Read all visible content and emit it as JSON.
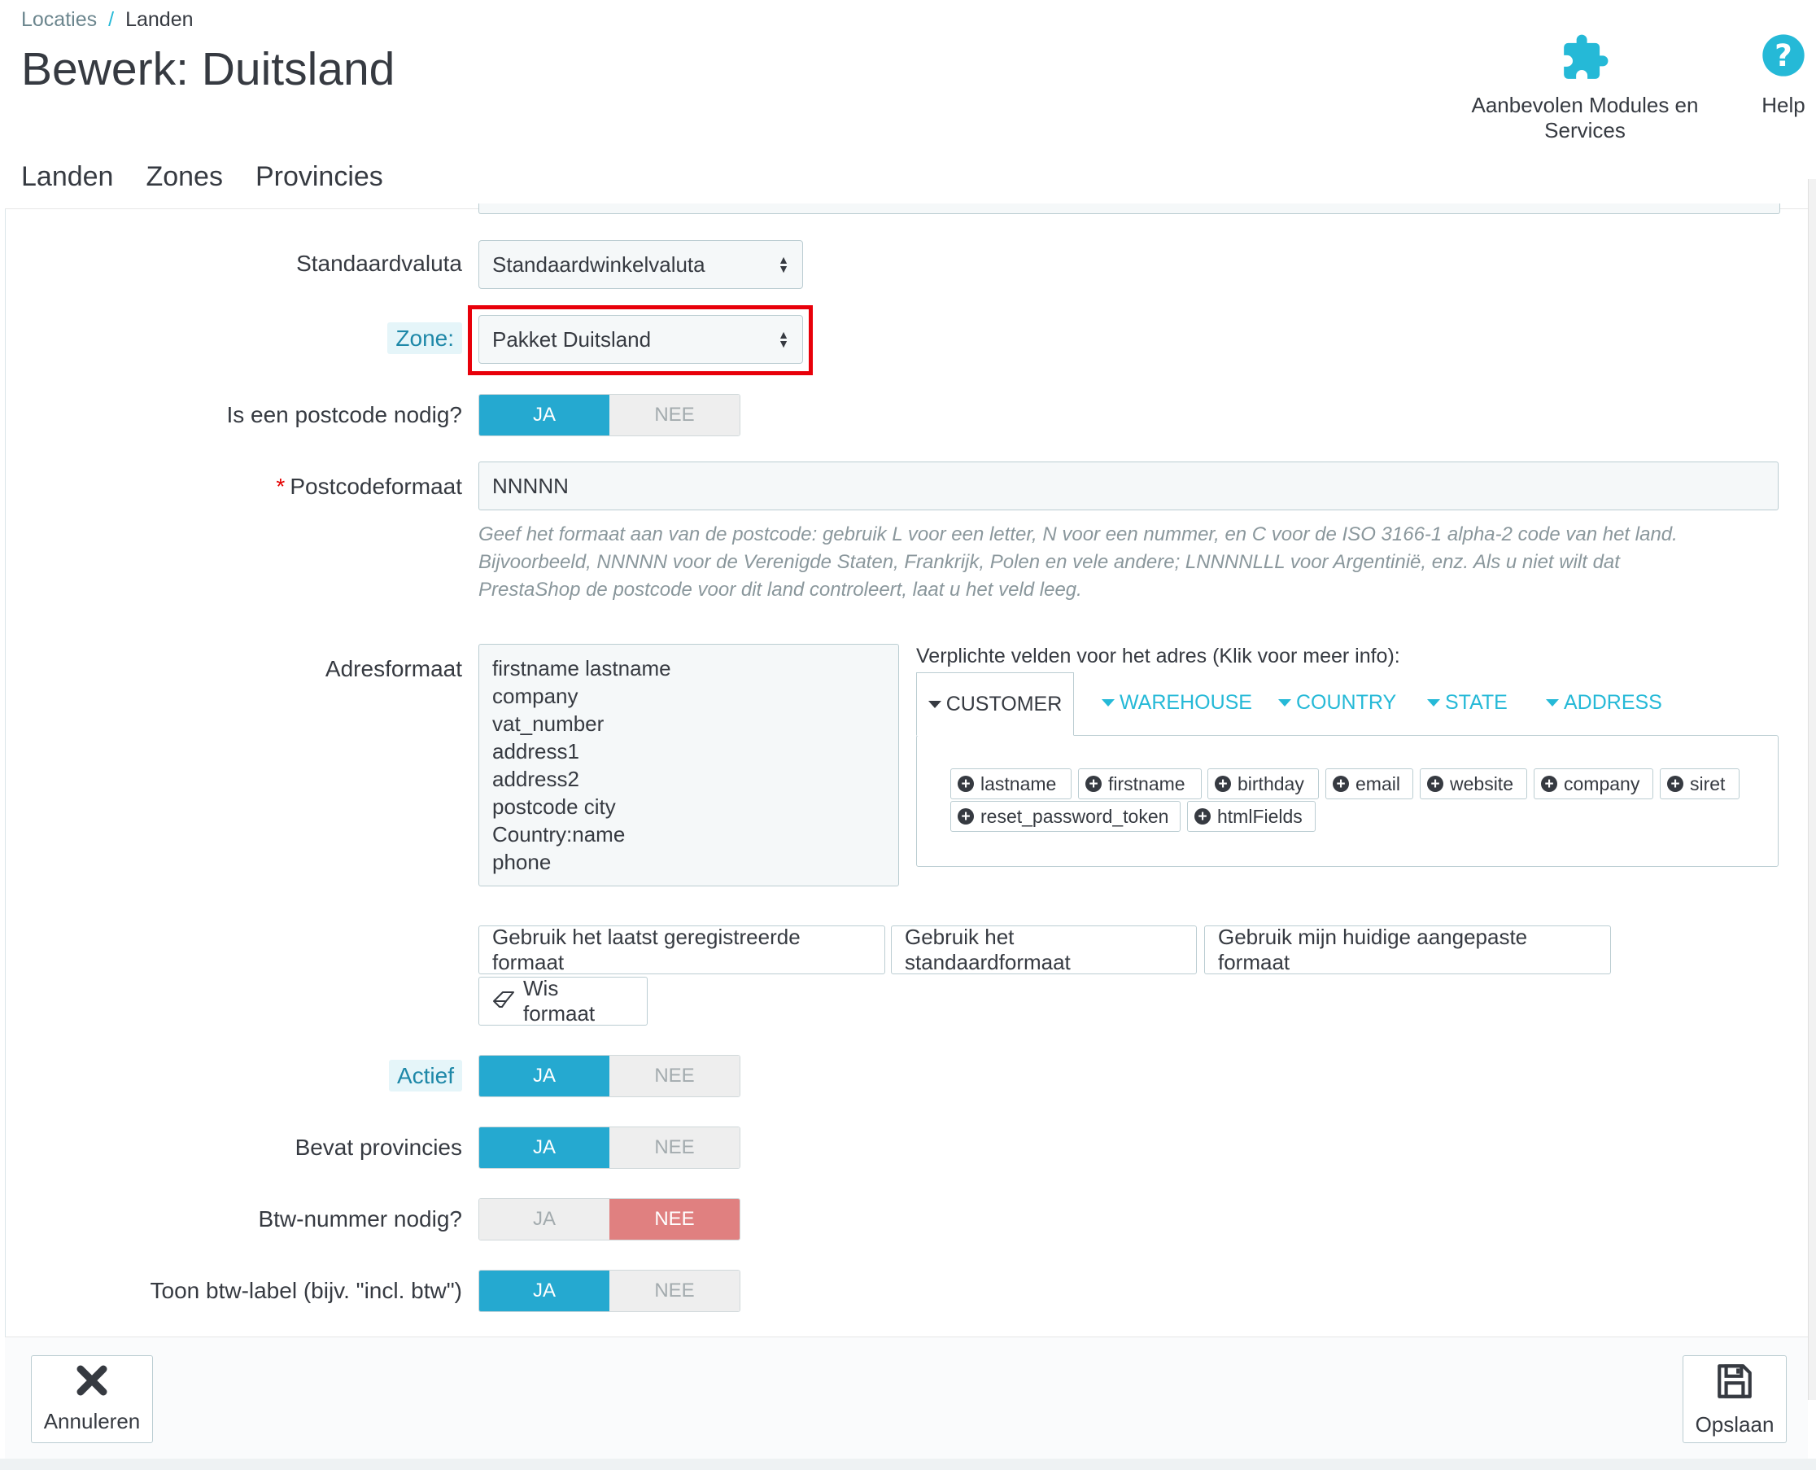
{
  "breadcrumb": {
    "parent": "Locaties",
    "separator": "/",
    "current": "Landen"
  },
  "page_title": "Bewerk: Duitsland",
  "toolbar": {
    "modules_label": "Aanbevolen Modules en Services",
    "help_label": "Help"
  },
  "tabs": [
    {
      "label": "Landen"
    },
    {
      "label": "Zones"
    },
    {
      "label": "Provincies"
    }
  ],
  "form": {
    "currency": {
      "label": "Standaardvaluta",
      "value": "Standaardwinkelvaluta"
    },
    "zone": {
      "label": "Zone:",
      "value": "Pakket Duitsland"
    },
    "zip_required": {
      "label": "Is een postcode nodig?",
      "yes": "JA",
      "no": "NEE",
      "value": "JA"
    },
    "zip_format": {
      "required_mark": "*",
      "label": "Postcodeformaat",
      "value": "NNNNN",
      "help_lines": [
        "Geef het formaat aan van de postcode: gebruik L voor een letter, N voor een nummer, en C voor de ISO 3166-1 alpha-2 code van het land.",
        "Bijvoorbeeld, NNNNN voor de Verenigde Staten, Frankrijk, Polen en vele andere; LNNNNLLL voor Argentinië, enz. Als u niet wilt dat",
        "PrestaShop de postcode voor dit land controleert, laat u het veld leeg."
      ]
    },
    "address_format": {
      "label": "Adresformaat",
      "lines": [
        "firstname lastname",
        "company",
        "vat_number",
        "address1",
        "address2",
        "postcode city",
        "Country:name",
        "phone"
      ]
    },
    "required_fields": {
      "title": "Verplichte velden voor het adres (Klik voor meer info):",
      "tabs": [
        "CUSTOMER",
        "WAREHOUSE",
        "COUNTRY",
        "STATE",
        "ADDRESS"
      ],
      "active_tab": "CUSTOMER",
      "chips": [
        "lastname",
        "firstname",
        "birthday",
        "email",
        "website",
        "company",
        "siret",
        "reset_password_token",
        "htmlFields"
      ]
    },
    "format_buttons": {
      "last": "Gebruik het laatst geregistreerde formaat",
      "default": "Gebruik het standaardformaat",
      "current": "Gebruik mijn huidige aangepaste formaat",
      "clear": "Wis formaat"
    },
    "active": {
      "label": "Actief",
      "yes": "JA",
      "no": "NEE",
      "value": "JA"
    },
    "has_states": {
      "label": "Bevat provincies",
      "yes": "JA",
      "no": "NEE",
      "value": "JA"
    },
    "vat_required": {
      "label": "Btw-nummer nodig?",
      "yes": "JA",
      "no": "NEE",
      "value": "NEE"
    },
    "show_vat_label": {
      "label": "Toon btw-label (bijv. \"incl. btw\")",
      "yes": "JA",
      "no": "NEE",
      "value": "JA"
    }
  },
  "footer": {
    "cancel_label": "Annuleren",
    "save_label": "Opslaan"
  },
  "colors": {
    "accent": "#25b9d7",
    "switch_on": "#25a9d0",
    "switch_no_on": "#e08080",
    "highlight": "#e8000a"
  },
  "icons": {
    "modules": "puzzle-icon",
    "help": "help-circle-icon",
    "cancel": "close-icon",
    "save": "floppy-disk-icon",
    "clear": "eraser-icon",
    "chip": "plus-circle-icon",
    "select": "select-arrows-icon"
  }
}
